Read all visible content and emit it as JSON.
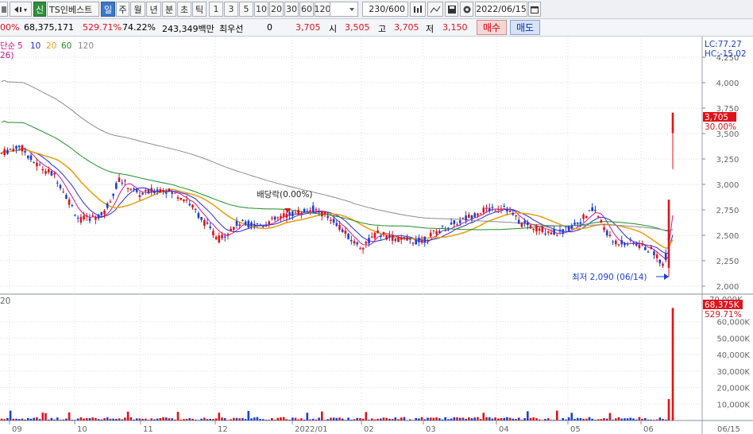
{
  "toolbar": {
    "badge": "신",
    "stock_name": "TS인베스트",
    "periods": [
      "일",
      "주",
      "월",
      "년",
      "분",
      "초",
      "틱"
    ],
    "active_period": "일",
    "intervals": [
      "1",
      "3",
      "5",
      "10",
      "20",
      "30",
      "60",
      "120"
    ],
    "count": "230",
    "count_total": "/600",
    "date": "2022/06/15"
  },
  "info": {
    "change_pct_partial": "00%",
    "volume": "68,375,171",
    "volume_pct": "529.71%",
    "turnover": "74.22%",
    "amount": "243,349백만",
    "priority_label": "최우선",
    "priority_value": "0",
    "price": "3,705",
    "open_label": "시",
    "open": "3,505",
    "high_label": "고",
    "high": "3,705",
    "low_label": "저",
    "low": "3,150",
    "buy_label": "매수",
    "sell_label": "매도"
  },
  "price_panel": {
    "legend_title": "단순",
    "ma_periods": [
      "5",
      "10",
      "20",
      "60",
      "120"
    ],
    "ma_colors": [
      "#d4148c",
      "#2a2ad6",
      "#e6a21a",
      "#1e8f2a",
      "#8c8c8c"
    ],
    "sub_legend": "26)",
    "top_right_lc": "LC:77.27",
    "top_right_hc": "HC:-15.02",
    "current_price": "3,705",
    "current_change": "30.00%",
    "annotation_dividend": "배당락(0.00%)",
    "annotation_low": "최저 2,090 (06/14)",
    "y_ticks": [
      "4,250",
      "4,000",
      "3,750",
      "3,500",
      "3,250",
      "3,000",
      "2,750",
      "2,500",
      "2,250",
      "2,000"
    ]
  },
  "volume_panel": {
    "left_label": "20",
    "top_right": "70,000K",
    "current_volume": "68,375K",
    "current_pct": "529.71%",
    "y_ticks": [
      "60,000K",
      "50,000K",
      "40,000K",
      "30,000K",
      "20,000K",
      "10,000K"
    ]
  },
  "x_axis": {
    "labels": [
      "09",
      "10",
      "11",
      "12",
      "2022/01",
      "02",
      "03",
      "04",
      "05",
      "06",
      "06/15"
    ]
  },
  "colors": {
    "up": "#e0121a",
    "down": "#1a3fd6",
    "grid": "#dddddd"
  },
  "chart_data": {
    "type": "candlestick",
    "title": "",
    "xlabel": "",
    "ylabel": "",
    "price_ylim": [
      2000,
      4250
    ],
    "volume_ylim": [
      0,
      70000
    ],
    "notes_visible": "Daily candles with MA 5/10/20/60/120; last bar close 3,705 (+30.00%), high 3,705, open 3,505, low 3,150; prior low 2,090 on 06/14",
    "monthly_closes_approx": [
      {
        "month": "09",
        "close": 3300
      },
      {
        "month": "10",
        "close": 2600
      },
      {
        "month": "11",
        "close": 2950
      },
      {
        "month": "12",
        "close": 2600
      },
      {
        "month": "2022/01",
        "close": 2700
      },
      {
        "month": "02",
        "close": 2500
      },
      {
        "month": "03",
        "close": 2550
      },
      {
        "month": "04",
        "close": 2750
      },
      {
        "month": "05",
        "close": 2550
      },
      {
        "month": "06",
        "close": 3705
      }
    ],
    "last_volume_k": 68375
  }
}
